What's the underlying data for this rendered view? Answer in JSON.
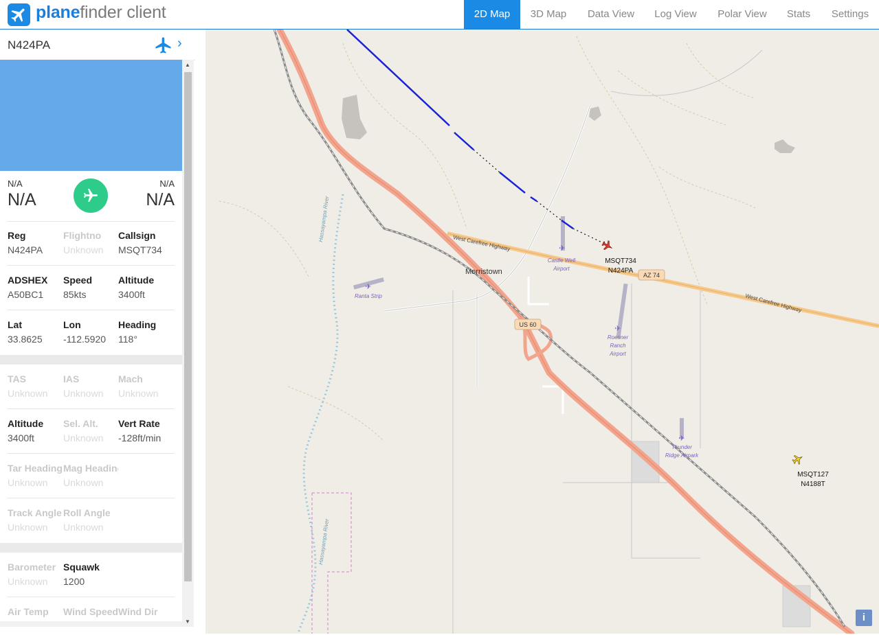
{
  "app": {
    "brand_bold": "plane",
    "brand_rest": "finder client"
  },
  "nav": [
    "2D Map",
    "3D Map",
    "Data View",
    "Log View",
    "Polar View",
    "Stats",
    "Settings"
  ],
  "active_tab": "2D Map",
  "sidebar": {
    "registration": "N424PA",
    "route": {
      "from_label": "N/A",
      "from_code": "N/A",
      "to_label": "N/A",
      "to_code": "N/A"
    },
    "fields": [
      {
        "key": "Reg",
        "value": "N424PA",
        "dim": false
      },
      {
        "key": "Flightno",
        "value": "Unknown",
        "dim": true
      },
      {
        "key": "Callsign",
        "value": "MSQT734",
        "dim": false
      },
      {
        "key": "ADSHEX",
        "value": "A50BC1",
        "dim": false
      },
      {
        "key": "Speed",
        "value": "85kts",
        "dim": false
      },
      {
        "key": "Altitude",
        "value": "3400ft",
        "dim": false
      },
      {
        "key": "Lat",
        "value": "33.8625",
        "dim": false
      },
      {
        "key": "Lon",
        "value": "-112.5920",
        "dim": false
      },
      {
        "key": "Heading",
        "value": "118°",
        "dim": false
      },
      {
        "key": "TAS",
        "value": "Unknown",
        "dim": true
      },
      {
        "key": "IAS",
        "value": "Unknown",
        "dim": true
      },
      {
        "key": "Mach",
        "value": "Unknown",
        "dim": true
      },
      {
        "key": "Altitude",
        "value": "3400ft",
        "dim": false
      },
      {
        "key": "Sel. Alt.",
        "value": "Unknown",
        "dim": true
      },
      {
        "key": "Vert Rate",
        "value": "-128ft/min",
        "dim": false
      },
      {
        "key": "Tar Heading",
        "value": "Unknown",
        "dim": true
      },
      {
        "key": "Mag Heading",
        "value": "Unknown",
        "dim": true
      },
      {
        "key": "Track Angle",
        "value": "Unknown",
        "dim": true
      },
      {
        "key": "Roll Angle",
        "value": "Unknown",
        "dim": true
      },
      {
        "key": "Barometer",
        "value": "Unknown",
        "dim": true
      },
      {
        "key": "Squawk",
        "value": "1200",
        "dim": false
      },
      {
        "key": "Air Temp",
        "value": "",
        "dim": true
      },
      {
        "key": "Wind Speed",
        "value": "",
        "dim": true
      },
      {
        "key": "Wind Dir",
        "value": "",
        "dim": true
      }
    ]
  },
  "map": {
    "places": [
      "Morristown"
    ],
    "roads": [
      "West Carefree Highway",
      "West Carefree Highway",
      "AZ 74",
      "US 60"
    ],
    "rivers": [
      "Hassayampa River",
      "Hassayampa River"
    ],
    "airports": [
      "Castle Well Airport",
      "Ranta Strip",
      "Roesner Ranch Airport",
      "Thunder Ridge Airpark"
    ],
    "aircraft": [
      {
        "callsign": "MSQT734",
        "reg": "N424PA",
        "selected": true
      },
      {
        "callsign": "MSQT127",
        "reg": "N4188T",
        "selected": false
      }
    ],
    "info_label": "i"
  },
  "colors": {
    "accent": "#1b8ae5",
    "photo": "#66a9ea",
    "route_icon": "#2ecc8b",
    "track": "#1a22d6",
    "highway": "#f2a48c"
  }
}
